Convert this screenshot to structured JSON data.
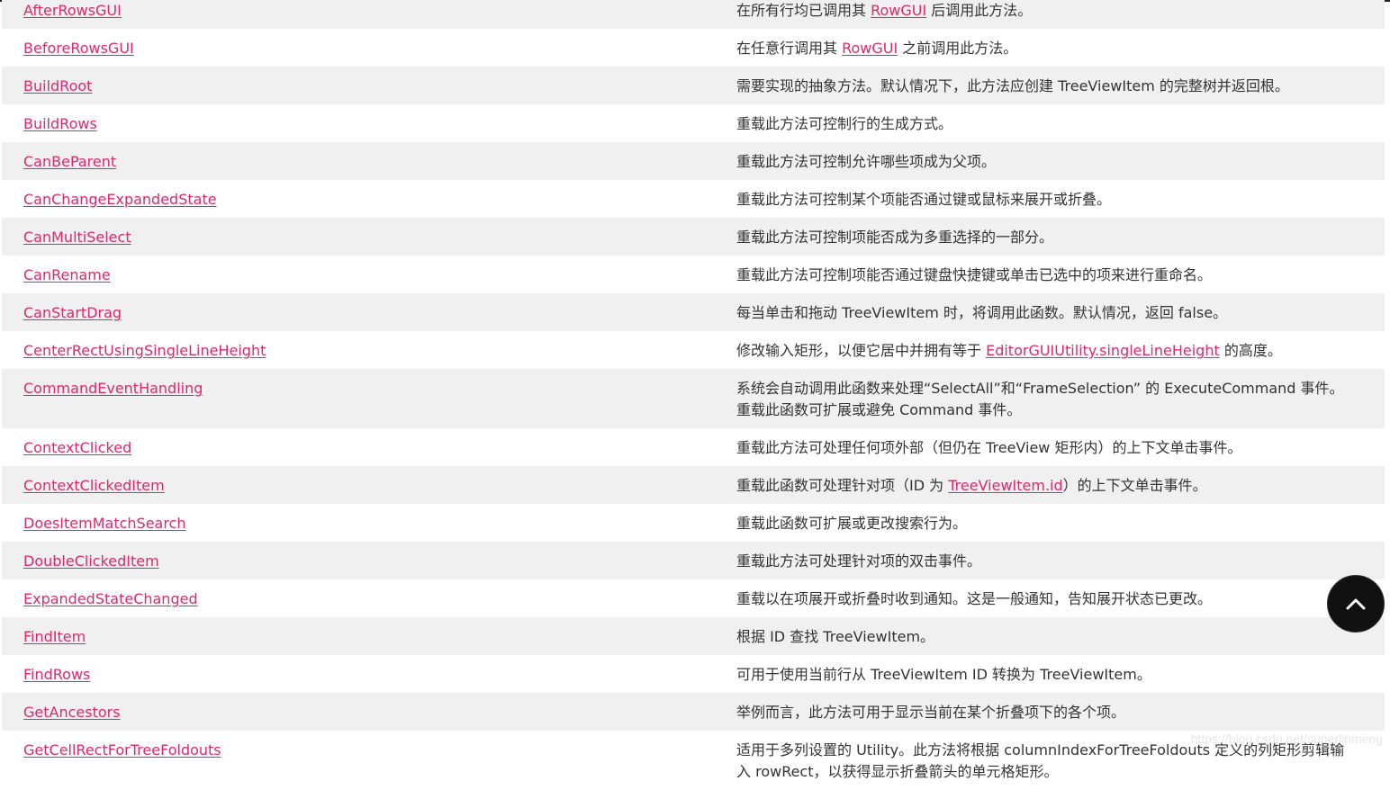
{
  "rows": [
    {
      "name": "AfterRowsGUI",
      "desc": [
        {
          "t": "在所有行均已调用其 "
        },
        {
          "link": "RowGUI"
        },
        {
          "t": " 后调用此方法。"
        }
      ]
    },
    {
      "name": "BeforeRowsGUI",
      "desc": [
        {
          "t": "在任意行调用其 "
        },
        {
          "link": "RowGUI"
        },
        {
          "t": " 之前调用此方法。"
        }
      ]
    },
    {
      "name": "BuildRoot",
      "desc": [
        {
          "t": "需要实现的抽象方法。默认情况下，此方法应创建 TreeViewItem 的完整树并返回根。"
        }
      ]
    },
    {
      "name": "BuildRows",
      "desc": [
        {
          "t": "重载此方法可控制行的生成方式。"
        }
      ]
    },
    {
      "name": "CanBeParent",
      "desc": [
        {
          "t": "重载此方法可控制允许哪些项成为父项。"
        }
      ]
    },
    {
      "name": "CanChangeExpandedState",
      "desc": [
        {
          "t": "重载此方法可控制某个项能否通过键或鼠标来展开或折叠。"
        }
      ]
    },
    {
      "name": "CanMultiSelect",
      "desc": [
        {
          "t": "重载此方法可控制项能否成为多重选择的一部分。"
        }
      ]
    },
    {
      "name": "CanRename",
      "desc": [
        {
          "t": "重载此方法可控制项能否通过键盘快捷键或单击已选中的项来进行重命名。"
        }
      ]
    },
    {
      "name": "CanStartDrag",
      "desc": [
        {
          "t": "每当单击和拖动 TreeViewItem 时，将调用此函数。默认情况，返回 false。"
        }
      ]
    },
    {
      "name": "CenterRectUsingSingleLineHeight",
      "desc": [
        {
          "t": "修改输入矩形，以便它居中并拥有等于 "
        },
        {
          "link": "EditorGUIUtility.singleLineHeight"
        },
        {
          "t": " 的高度。"
        }
      ]
    },
    {
      "name": "CommandEventHandling",
      "tall": true,
      "desc": [
        {
          "t": "系统会自动调用此函数来处理“SelectAll”和“FrameSelection” 的 ExecuteCommand 事件。重载此函数可扩展或避免 Command 事件。"
        }
      ]
    },
    {
      "name": "ContextClicked",
      "desc": [
        {
          "t": "重载此方法可处理任何项外部（但仍在 TreeView 矩形内）的上下文单击事件。"
        }
      ]
    },
    {
      "name": "ContextClickedItem",
      "desc": [
        {
          "t": "重载此函数可处理针对项（ID 为 "
        },
        {
          "link": "TreeViewItem.id"
        },
        {
          "t": "）的上下文单击事件。"
        }
      ]
    },
    {
      "name": "DoesItemMatchSearch",
      "desc": [
        {
          "t": "重载此函数可扩展或更改搜索行为。"
        }
      ]
    },
    {
      "name": "DoubleClickedItem",
      "desc": [
        {
          "t": "重载此方法可处理针对项的双击事件。"
        }
      ]
    },
    {
      "name": "ExpandedStateChanged",
      "desc": [
        {
          "t": "重载以在项展开或折叠时收到通知。这是一般通知，告知展开状态已更改。"
        }
      ]
    },
    {
      "name": "FindItem",
      "desc": [
        {
          "t": "根据 ID 查找 TreeViewItem。"
        }
      ]
    },
    {
      "name": "FindRows",
      "desc": [
        {
          "t": "可用于使用当前行从 TreeViewItem ID 转换为 TreeViewItem。"
        }
      ]
    },
    {
      "name": "GetAncestors",
      "desc": [
        {
          "t": "举例而言，此方法可用于显示当前在某个折叠项下的各个项。"
        }
      ]
    },
    {
      "name": "GetCellRectForTreeFoldouts",
      "tall": true,
      "desc": [
        {
          "t": "适用于多列设置的 Utility。此方法将根据 columnIndexForTreeFoldouts 定义的列矩形剪辑输入 rowRect，以获得显示折叠箭头的单元格矩形。"
        }
      ]
    }
  ],
  "watermark": "https://blog.csdn.net/superlinmeng",
  "scroll_top": {
    "icon": "chevron-up-icon"
  },
  "colors": {
    "link": "#e0276b",
    "row_alt": "#f0f0f0",
    "text": "#333333",
    "fab": "#111111"
  }
}
